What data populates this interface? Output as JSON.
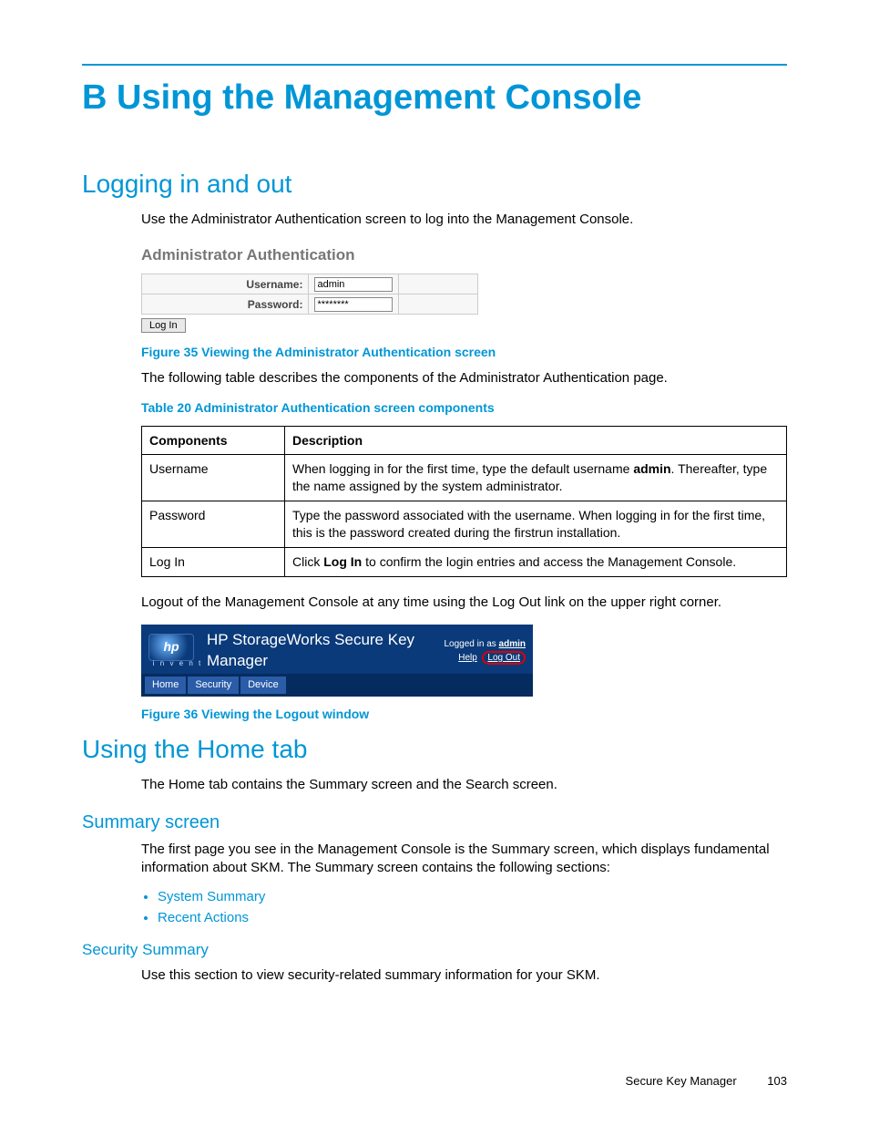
{
  "page": {
    "title": "B Using the Management Console",
    "footer_product": "Secure Key Manager",
    "footer_page": "103"
  },
  "sec_login": {
    "heading": "Logging in and out",
    "intro": "Use the Administrator Authentication screen to log into the Management Console.",
    "auth_panel": {
      "title": "Administrator Authentication",
      "username_label": "Username:",
      "username_value": "admin",
      "password_label": "Password:",
      "password_value": "********",
      "login_button": "Log In"
    },
    "fig35": "Figure 35 Viewing the Administrator Authentication screen",
    "table_intro": "The following table describes the components of the Administrator Authentication page.",
    "table_caption": "Table 20 Administrator Authentication screen components",
    "table": {
      "headers": [
        "Components",
        "Description"
      ],
      "rows": [
        {
          "c": "Username",
          "d_pre": "When logging in for the first time, type the default username ",
          "d_bold": "admin",
          "d_post": ". Thereafter, type the name assigned by the system administrator."
        },
        {
          "c": "Password",
          "d_pre": "Type the password associated with the username. When logging in for the first time, this is the password created during the firstrun installation.",
          "d_bold": "",
          "d_post": ""
        },
        {
          "c": "Log In",
          "d_pre": "Click ",
          "d_bold": "Log In",
          "d_post": " to confirm the login entries and access the Management Console."
        }
      ]
    },
    "logout_para": "Logout of the Management Console at any time using the Log Out link on the upper right corner.",
    "banner": {
      "product": "HP StorageWorks Secure Key Manager",
      "logged_in_pre": "Logged in as ",
      "logged_in_user": "admin",
      "help": "Help",
      "logout": "Log Out",
      "tabs": [
        "Home",
        "Security",
        "Device"
      ],
      "invent": "i n v e n t",
      "logo_text": "hp"
    },
    "fig36": "Figure 36 Viewing the Logout window"
  },
  "sec_home": {
    "heading": "Using the Home tab",
    "intro": "The Home tab contains the Summary screen and the Search screen.",
    "summary": {
      "heading": "Summary screen",
      "para": "The first page you see in the Management Console is the Summary screen, which displays fundamental information about SKM. The Summary screen contains the following sections:",
      "bullets": [
        "System Summary",
        "Recent Actions"
      ]
    },
    "security": {
      "heading": "Security Summary",
      "para": "Use this section to view security-related summary information for your SKM."
    }
  }
}
